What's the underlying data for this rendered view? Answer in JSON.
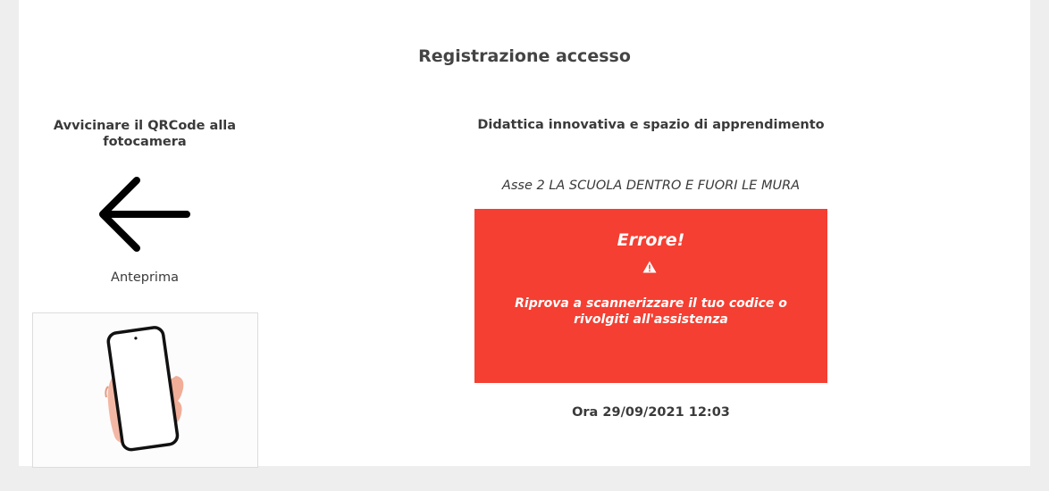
{
  "page": {
    "title": "Registrazione accesso"
  },
  "scanner": {
    "instruction": "Avvicinare il QRCode alla fotocamera",
    "arrow_icon": "arrow-left-icon",
    "preview_label": "Anteprima",
    "preview_image": "hand-holding-phone"
  },
  "course": {
    "title": "Didattica innovativa e spazio di apprendimento",
    "subtitle": "Asse 2 LA SCUOLA DENTRO E FUORI LE MURA"
  },
  "error": {
    "title": "Errore!",
    "icon": "warning-icon",
    "message": "Riprova a scannerizzare il tuo codice o rivolgiti all'assistenza",
    "background_color": "#f43f32"
  },
  "status": {
    "timestamp": "Ora 29/09/2021 12:03"
  }
}
